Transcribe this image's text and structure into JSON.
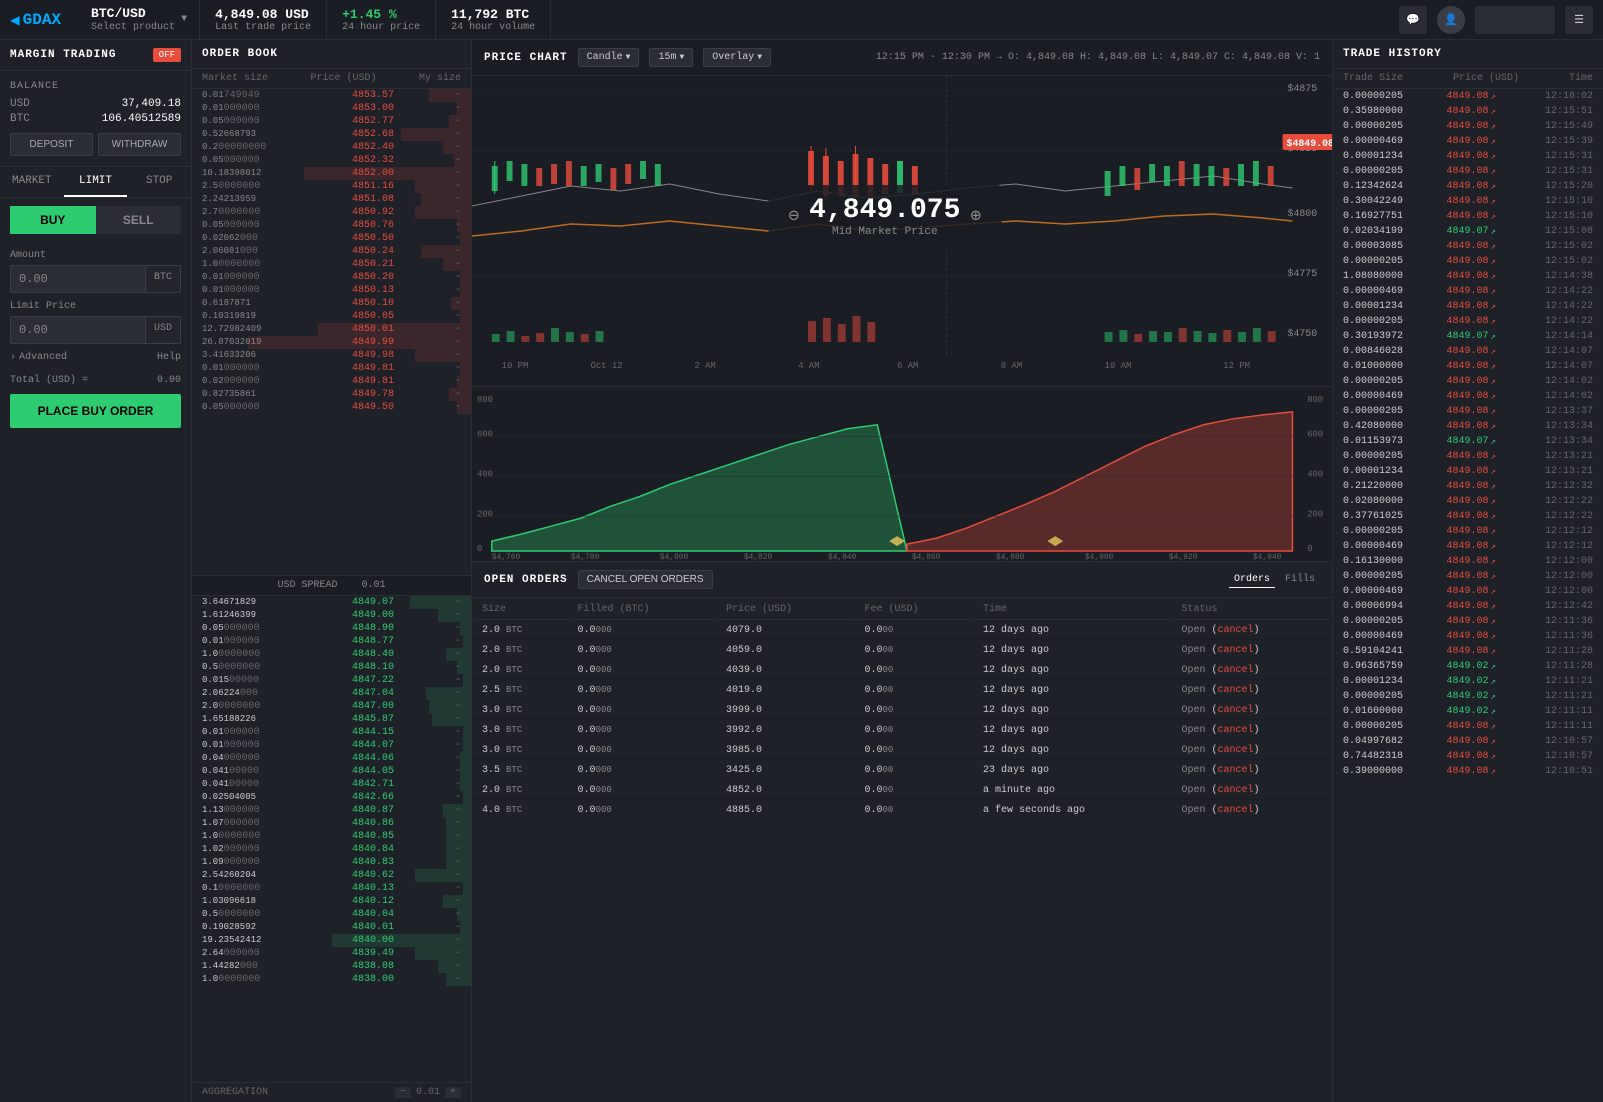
{
  "topbar": {
    "logo": "GDAX",
    "pair": "BTC/USD",
    "pair_sub": "Select product",
    "last_trade_price": "4,849.08 USD",
    "last_trade_label": "Last trade price",
    "change_24h": "+1.45 %",
    "change_24h_label": "24 hour price",
    "volume_24h": "11,792 BTC",
    "volume_24h_label": "24 hour volume"
  },
  "left": {
    "margin_title": "MARGIN TRADING",
    "margin_toggle": "OFF",
    "balance_title": "BALANCE",
    "usd_label": "USD",
    "usd_amount": "37,409.18",
    "btc_label": "BTC",
    "btc_amount": "106.40512589",
    "deposit_label": "DEPOSIT",
    "withdraw_label": "WITHDRAW",
    "tab_market": "MARKET",
    "tab_limit": "LIMIT",
    "tab_stop": "STOP",
    "buy_label": "BUY",
    "sell_label": "SELL",
    "amount_label": "Amount",
    "amount_placeholder": "0.00",
    "amount_unit": "BTC",
    "limit_price_label": "Limit Price",
    "limit_placeholder": "0.00",
    "limit_unit": "USD",
    "advanced_label": "Advanced",
    "help_label": "Help",
    "total_label": "Total (USD) =",
    "total_val": "0.00",
    "place_order_label": "PLACE BUY ORDER"
  },
  "order_book": {
    "title": "ORDER BOOK",
    "col_market_size": "Market size",
    "col_price": "Price (USD)",
    "col_my_size": "My size",
    "asks": [
      {
        "size": "0.01",
        "full_size": "0.01749949",
        "price": "4853.57",
        "my": "-"
      },
      {
        "size": "0.01",
        "full_size": "0.01000000",
        "price": "4853.00",
        "my": "-"
      },
      {
        "size": "0.05",
        "full_size": "0.05000000",
        "price": "4852.77",
        "my": "-"
      },
      {
        "size": "0.52668793",
        "full_size": "0.52668793",
        "price": "4852.68",
        "my": "-"
      },
      {
        "size": "0.2",
        "full_size": "0.20000000",
        "price": "4852.40",
        "my": "-"
      },
      {
        "size": "0.05",
        "full_size": "0.05000000",
        "price": "4852.32",
        "my": "-"
      },
      {
        "size": "10.18398012",
        "full_size": "10.18398012",
        "price": "4852.00",
        "my": "-"
      },
      {
        "size": "2.5",
        "full_size": "2.50000000",
        "price": "4851.16",
        "my": "-"
      },
      {
        "size": "2.24213959",
        "full_size": "2.24213959",
        "price": "4851.08",
        "my": "-"
      },
      {
        "size": "2.7",
        "full_size": "2.70000000",
        "price": "4850.92",
        "my": "-"
      },
      {
        "size": "0.05",
        "full_size": "0.05000000",
        "price": "4850.76",
        "my": "-"
      },
      {
        "size": "0.02062",
        "full_size": "0.02062000",
        "price": "4850.50",
        "my": "-"
      },
      {
        "size": "2.06081",
        "full_size": "2.06081000",
        "price": "4850.24",
        "my": "-"
      },
      {
        "size": "1.0",
        "full_size": "1.00000000",
        "price": "4850.21",
        "my": "-"
      },
      {
        "size": "0.01",
        "full_size": "0.01000000",
        "price": "4850.20",
        "my": "-"
      },
      {
        "size": "0.01",
        "full_size": "0.01000000",
        "price": "4850.13",
        "my": "-"
      },
      {
        "size": "0.6187871",
        "full_size": "0.61878710",
        "price": "4850.10",
        "my": "-"
      },
      {
        "size": "0.10319819",
        "full_size": "0.10319819",
        "price": "4850.05",
        "my": "-"
      },
      {
        "size": "12.72982409",
        "full_size": "12.72982409",
        "price": "4850.01",
        "my": "-"
      },
      {
        "size": "26.87032019",
        "full_size": "26.87032019",
        "price": "4849.99",
        "my": "-"
      },
      {
        "size": "3.41633206",
        "full_size": "3.41633206",
        "price": "4849.98",
        "my": "-"
      },
      {
        "size": "0.01",
        "full_size": "0.01000000",
        "price": "4849.81",
        "my": "-"
      },
      {
        "size": "0.02",
        "full_size": "0.02000000",
        "price": "4849.81",
        "my": "-"
      },
      {
        "size": "0.82735861",
        "full_size": "0.82735861",
        "price": "4849.78",
        "my": "-"
      },
      {
        "size": "0.05",
        "full_size": "0.05000000",
        "price": "4849.50",
        "my": "-"
      }
    ],
    "spread_label": "USD SPREAD",
    "spread_val": "0.01",
    "bids": [
      {
        "size": "3.64671829",
        "full_size": "3.64671829",
        "price": "4849.07",
        "my": "-"
      },
      {
        "size": "1.61246399",
        "full_size": "1.61246399",
        "price": "4849.00",
        "my": "-"
      },
      {
        "size": "0.05",
        "full_size": "0.05000000",
        "price": "4848.90",
        "my": "-"
      },
      {
        "size": "0.01",
        "full_size": "0.01000000",
        "price": "4848.77",
        "my": "-"
      },
      {
        "size": "1.0",
        "full_size": "1.00000000",
        "price": "4848.40",
        "my": "-"
      },
      {
        "size": "0.5",
        "full_size": "0.50000000",
        "price": "4848.10",
        "my": "-"
      },
      {
        "size": "0.015",
        "full_size": "0.01500000",
        "price": "4847.22",
        "my": "-"
      },
      {
        "size": "2.06224",
        "full_size": "2.06224000",
        "price": "4847.04",
        "my": "-"
      },
      {
        "size": "2.0",
        "full_size": "2.00000000",
        "price": "4847.00",
        "my": "-"
      },
      {
        "size": "1.65188226",
        "full_size": "1.65188226",
        "price": "4845.87",
        "my": "-"
      },
      {
        "size": "0.01",
        "full_size": "0.01000000",
        "price": "4844.15",
        "my": "-"
      },
      {
        "size": "0.01",
        "full_size": "0.01000000",
        "price": "4844.07",
        "my": "-"
      },
      {
        "size": "0.04",
        "full_size": "0.04000000",
        "price": "4844.06",
        "my": "-"
      },
      {
        "size": "0.041",
        "full_size": "0.04100000",
        "price": "4844.05",
        "my": "-"
      },
      {
        "size": "0.041",
        "full_size": "0.04100000",
        "price": "4842.71",
        "my": "-"
      },
      {
        "size": "0.02504005",
        "full_size": "0.02504005",
        "price": "4842.66",
        "my": "-"
      },
      {
        "size": "1.13",
        "full_size": "1.13000000",
        "price": "4840.87",
        "my": "-"
      },
      {
        "size": "1.07",
        "full_size": "1.07000000",
        "price": "4840.86",
        "my": "-"
      },
      {
        "size": "1.0",
        "full_size": "1.00000000",
        "price": "4840.85",
        "my": "-"
      },
      {
        "size": "1.02",
        "full_size": "1.02000000",
        "price": "4840.84",
        "my": "-"
      },
      {
        "size": "1.09",
        "full_size": "1.09000000",
        "price": "4840.83",
        "my": "-"
      },
      {
        "size": "2.54260204",
        "full_size": "2.54260204",
        "price": "4840.62",
        "my": "-"
      },
      {
        "size": "0.1",
        "full_size": "0.10000000",
        "price": "4840.13",
        "my": "-"
      },
      {
        "size": "1.03096618",
        "full_size": "1.03096618",
        "price": "4840.12",
        "my": "-"
      },
      {
        "size": "0.5",
        "full_size": "0.50000000",
        "price": "4840.04",
        "my": "-"
      },
      {
        "size": "0.19028592",
        "full_size": "0.19028592",
        "price": "4840.01",
        "my": "-"
      },
      {
        "size": "19.23542412",
        "full_size": "19.23542412",
        "price": "4840.00",
        "my": "-"
      },
      {
        "size": "2.64",
        "full_size": "2.64000000",
        "price": "4839.49",
        "my": "-"
      },
      {
        "size": "1.44282",
        "full_size": "1.44282000",
        "price": "4838.08",
        "my": "-"
      },
      {
        "size": "1.0",
        "full_size": "1.00000000",
        "price": "4838.00",
        "my": "-"
      }
    ],
    "aggregation_label": "AGGREGATION",
    "aggregation_val": "0.01"
  },
  "chart": {
    "title": "PRICE CHART",
    "candle_label": "Candle",
    "interval_label": "15m",
    "overlay_label": "Overlay",
    "ohlc": "12:15 PM - 12:30 PM →  O: 4,849.08  H: 4,849.08  L: 4,849.07  C: 4,849.08  V: 1",
    "mid_market_price": "4,849.075",
    "mid_market_label": "Mid Market Price",
    "price_levels": [
      "$4875",
      "$4849.08",
      "$4825",
      "$4800",
      "$4775",
      "$4750"
    ],
    "x_labels": [
      "10 PM",
      "Oct 12",
      "2 AM",
      "4 AM",
      "6 AM",
      "8 AM",
      "10 AM",
      "12 PM"
    ],
    "depth_x_labels": [
      "$4,760",
      "$4,780",
      "$4,800",
      "$4,820",
      "$4,840",
      "$4,860",
      "$4,880",
      "$4,900",
      "$4,920",
      "$4,940"
    ],
    "depth_y_labels": [
      "0",
      "200",
      "400",
      "600",
      "800"
    ],
    "depth_right_labels": [
      "0",
      "200",
      "400",
      "600",
      "800"
    ]
  },
  "open_orders": {
    "title": "OPEN ORDERS",
    "cancel_all_label": "CANCEL OPEN ORDERS",
    "orders_tab": "Orders",
    "fills_tab": "Fills",
    "col_size": "Size",
    "col_filled": "Filled (BTC)",
    "col_price": "Price (USD)",
    "col_fee": "Fee (USD)",
    "col_time": "Time",
    "col_status": "Status",
    "rows": [
      {
        "size": "2.0",
        "size_unit": "BTC",
        "filled": "0.0",
        "filled_frac": "000",
        "price": "4079.0",
        "fee": "0.0",
        "fee_frac": "00",
        "time": "12 days ago",
        "status": "Open",
        "cancel": "cancel"
      },
      {
        "size": "2.0",
        "size_unit": "BTC",
        "filled": "0.0",
        "filled_frac": "000",
        "price": "4059.0",
        "fee": "0.0",
        "fee_frac": "00",
        "time": "12 days ago",
        "status": "Open",
        "cancel": "cancel"
      },
      {
        "size": "2.0",
        "size_unit": "BTC",
        "filled": "0.0",
        "filled_frac": "000",
        "price": "4039.0",
        "fee": "0.0",
        "fee_frac": "00",
        "time": "12 days ago",
        "status": "Open",
        "cancel": "cancel"
      },
      {
        "size": "2.5",
        "size_unit": "BTC",
        "filled": "0.0",
        "filled_frac": "000",
        "price": "4019.0",
        "fee": "0.0",
        "fee_frac": "00",
        "time": "12 days ago",
        "status": "Open",
        "cancel": "cancel"
      },
      {
        "size": "3.0",
        "size_unit": "BTC",
        "filled": "0.0",
        "filled_frac": "000",
        "price": "3999.0",
        "fee": "0.0",
        "fee_frac": "00",
        "time": "12 days ago",
        "status": "Open",
        "cancel": "cancel"
      },
      {
        "size": "3.0",
        "size_unit": "BTC",
        "filled": "0.0",
        "filled_frac": "000",
        "price": "3992.0",
        "fee": "0.0",
        "fee_frac": "00",
        "time": "12 days ago",
        "status": "Open",
        "cancel": "cancel"
      },
      {
        "size": "3.0",
        "size_unit": "BTC",
        "filled": "0.0",
        "filled_frac": "000",
        "price": "3985.0",
        "fee": "0.0",
        "fee_frac": "00",
        "time": "12 days ago",
        "status": "Open",
        "cancel": "cancel"
      },
      {
        "size": "3.5",
        "size_unit": "BTC",
        "filled": "0.0",
        "filled_frac": "000",
        "price": "3425.0",
        "fee": "0.0",
        "fee_frac": "00",
        "time": "23 days ago",
        "status": "Open",
        "cancel": "cancel"
      },
      {
        "size": "2.0",
        "size_unit": "BTC",
        "filled": "0.0",
        "filled_frac": "000",
        "price": "4852.0",
        "fee": "0.0",
        "fee_frac": "00",
        "time": "a minute ago",
        "status": "Open",
        "cancel": "cancel"
      },
      {
        "size": "4.0",
        "size_unit": "BTC",
        "filled": "0.0",
        "filled_frac": "000",
        "price": "4885.0",
        "fee": "0.0",
        "fee_frac": "00",
        "time": "a few seconds ago",
        "status": "Open",
        "cancel": "cancel"
      }
    ]
  },
  "trade_history": {
    "title": "TRADE HISTORY",
    "col_trade_size": "Trade Size",
    "col_price": "Price (USD)",
    "col_time": "Time",
    "rows": [
      {
        "size": "0.00000205",
        "price": "4849.08",
        "dir": "up",
        "time": "12:16:02"
      },
      {
        "size": "0.35980000",
        "price": "4849.08",
        "dir": "up",
        "time": "12:15:51"
      },
      {
        "size": "0.00000205",
        "price": "4849.08",
        "dir": "up",
        "time": "12:15:49"
      },
      {
        "size": "0.00000469",
        "price": "4849.08",
        "dir": "up",
        "time": "12:15:39"
      },
      {
        "size": "0.00001234",
        "price": "4849.08",
        "dir": "up",
        "time": "12:15:31"
      },
      {
        "size": "0.00000205",
        "price": "4849.08",
        "dir": "up",
        "time": "12:15:31"
      },
      {
        "size": "0.12342624",
        "price": "4849.08",
        "dir": "up",
        "time": "12:15:20"
      },
      {
        "size": "0.30042249",
        "price": "4849.08",
        "dir": "up",
        "time": "12:15:10"
      },
      {
        "size": "0.16927751",
        "price": "4849.08",
        "dir": "up",
        "time": "12:15:10"
      },
      {
        "size": "0.02034199",
        "price": "4849.07",
        "dir": "down",
        "time": "12:15:08"
      },
      {
        "size": "0.00003085",
        "price": "4849.08",
        "dir": "up",
        "time": "12:15:02"
      },
      {
        "size": "0.00000205",
        "price": "4849.08",
        "dir": "up",
        "time": "12:15:02"
      },
      {
        "size": "1.08080000",
        "price": "4849.08",
        "dir": "up",
        "time": "12:14:38"
      },
      {
        "size": "0.00000469",
        "price": "4849.08",
        "dir": "up",
        "time": "12:14:22"
      },
      {
        "size": "0.00001234",
        "price": "4849.08",
        "dir": "up",
        "time": "12:14:22"
      },
      {
        "size": "0.00000205",
        "price": "4849.08",
        "dir": "up",
        "time": "12:14:22"
      },
      {
        "size": "0.30193972",
        "price": "4849.07",
        "dir": "down",
        "time": "12:14:14"
      },
      {
        "size": "0.00846028",
        "price": "4849.08",
        "dir": "up",
        "time": "12:14:07"
      },
      {
        "size": "0.01000000",
        "price": "4849.08",
        "dir": "up",
        "time": "12:14:07"
      },
      {
        "size": "0.00000205",
        "price": "4849.08",
        "dir": "up",
        "time": "12:14:02"
      },
      {
        "size": "0.00000469",
        "price": "4849.08",
        "dir": "up",
        "time": "12:14:02"
      },
      {
        "size": "0.00000205",
        "price": "4849.08",
        "dir": "up",
        "time": "12:13:37"
      },
      {
        "size": "0.42080000",
        "price": "4849.08",
        "dir": "up",
        "time": "12:13:34"
      },
      {
        "size": "0.01153973",
        "price": "4849.07",
        "dir": "down",
        "time": "12:13:34"
      },
      {
        "size": "0.00000205",
        "price": "4849.08",
        "dir": "up",
        "time": "12:13:21"
      },
      {
        "size": "0.00001234",
        "price": "4849.08",
        "dir": "up",
        "time": "12:13:21"
      },
      {
        "size": "0.21220000",
        "price": "4849.08",
        "dir": "up",
        "time": "12:12:32"
      },
      {
        "size": "0.02080000",
        "price": "4849.08",
        "dir": "up",
        "time": "12:12:22"
      },
      {
        "size": "0.37761025",
        "price": "4849.08",
        "dir": "up",
        "time": "12:12:22"
      },
      {
        "size": "0.00000205",
        "price": "4849.08",
        "dir": "up",
        "time": "12:12:12"
      },
      {
        "size": "0.00000469",
        "price": "4849.08",
        "dir": "up",
        "time": "12:12:12"
      },
      {
        "size": "0.16130000",
        "price": "4849.08",
        "dir": "up",
        "time": "12:12:00"
      },
      {
        "size": "0.00000205",
        "price": "4849.08",
        "dir": "up",
        "time": "12:12:00"
      },
      {
        "size": "0.00000469",
        "price": "4849.08",
        "dir": "up",
        "time": "12:12:00"
      },
      {
        "size": "0.00006994",
        "price": "4849.08",
        "dir": "up",
        "time": "12:12:42"
      },
      {
        "size": "0.00000205",
        "price": "4849.08",
        "dir": "up",
        "time": "12:11:36"
      },
      {
        "size": "0.00000469",
        "price": "4849.08",
        "dir": "up",
        "time": "12:11:36"
      },
      {
        "size": "0.59104241",
        "price": "4849.08",
        "dir": "up",
        "time": "12:11:28"
      },
      {
        "size": "0.96365759",
        "price": "4849.02",
        "dir": "down",
        "time": "12:11:28"
      },
      {
        "size": "0.00001234",
        "price": "4849.02",
        "dir": "down",
        "time": "12:11:21"
      },
      {
        "size": "0.00000205",
        "price": "4849.02",
        "dir": "down",
        "time": "12:11:21"
      },
      {
        "size": "0.01600000",
        "price": "4849.02",
        "dir": "down",
        "time": "12:11:11"
      },
      {
        "size": "0.00000205",
        "price": "4849.08",
        "dir": "up",
        "time": "12:11:11"
      },
      {
        "size": "0.04997682",
        "price": "4849.08",
        "dir": "up",
        "time": "12:10:57"
      },
      {
        "size": "0.74482318",
        "price": "4849.08",
        "dir": "up",
        "time": "12:10:57"
      },
      {
        "size": "0.39000000",
        "price": "4849.08",
        "dir": "up",
        "time": "12:10:51"
      }
    ]
  },
  "colors": {
    "buy": "#2ecc71",
    "sell": "#e74c3c",
    "bg_dark": "#1a1d23",
    "bg_panel": "#1e2128",
    "border": "#2a2d35",
    "text_muted": "#888",
    "text_price_up": "#e74c3c",
    "text_price_down": "#2ecc71"
  }
}
